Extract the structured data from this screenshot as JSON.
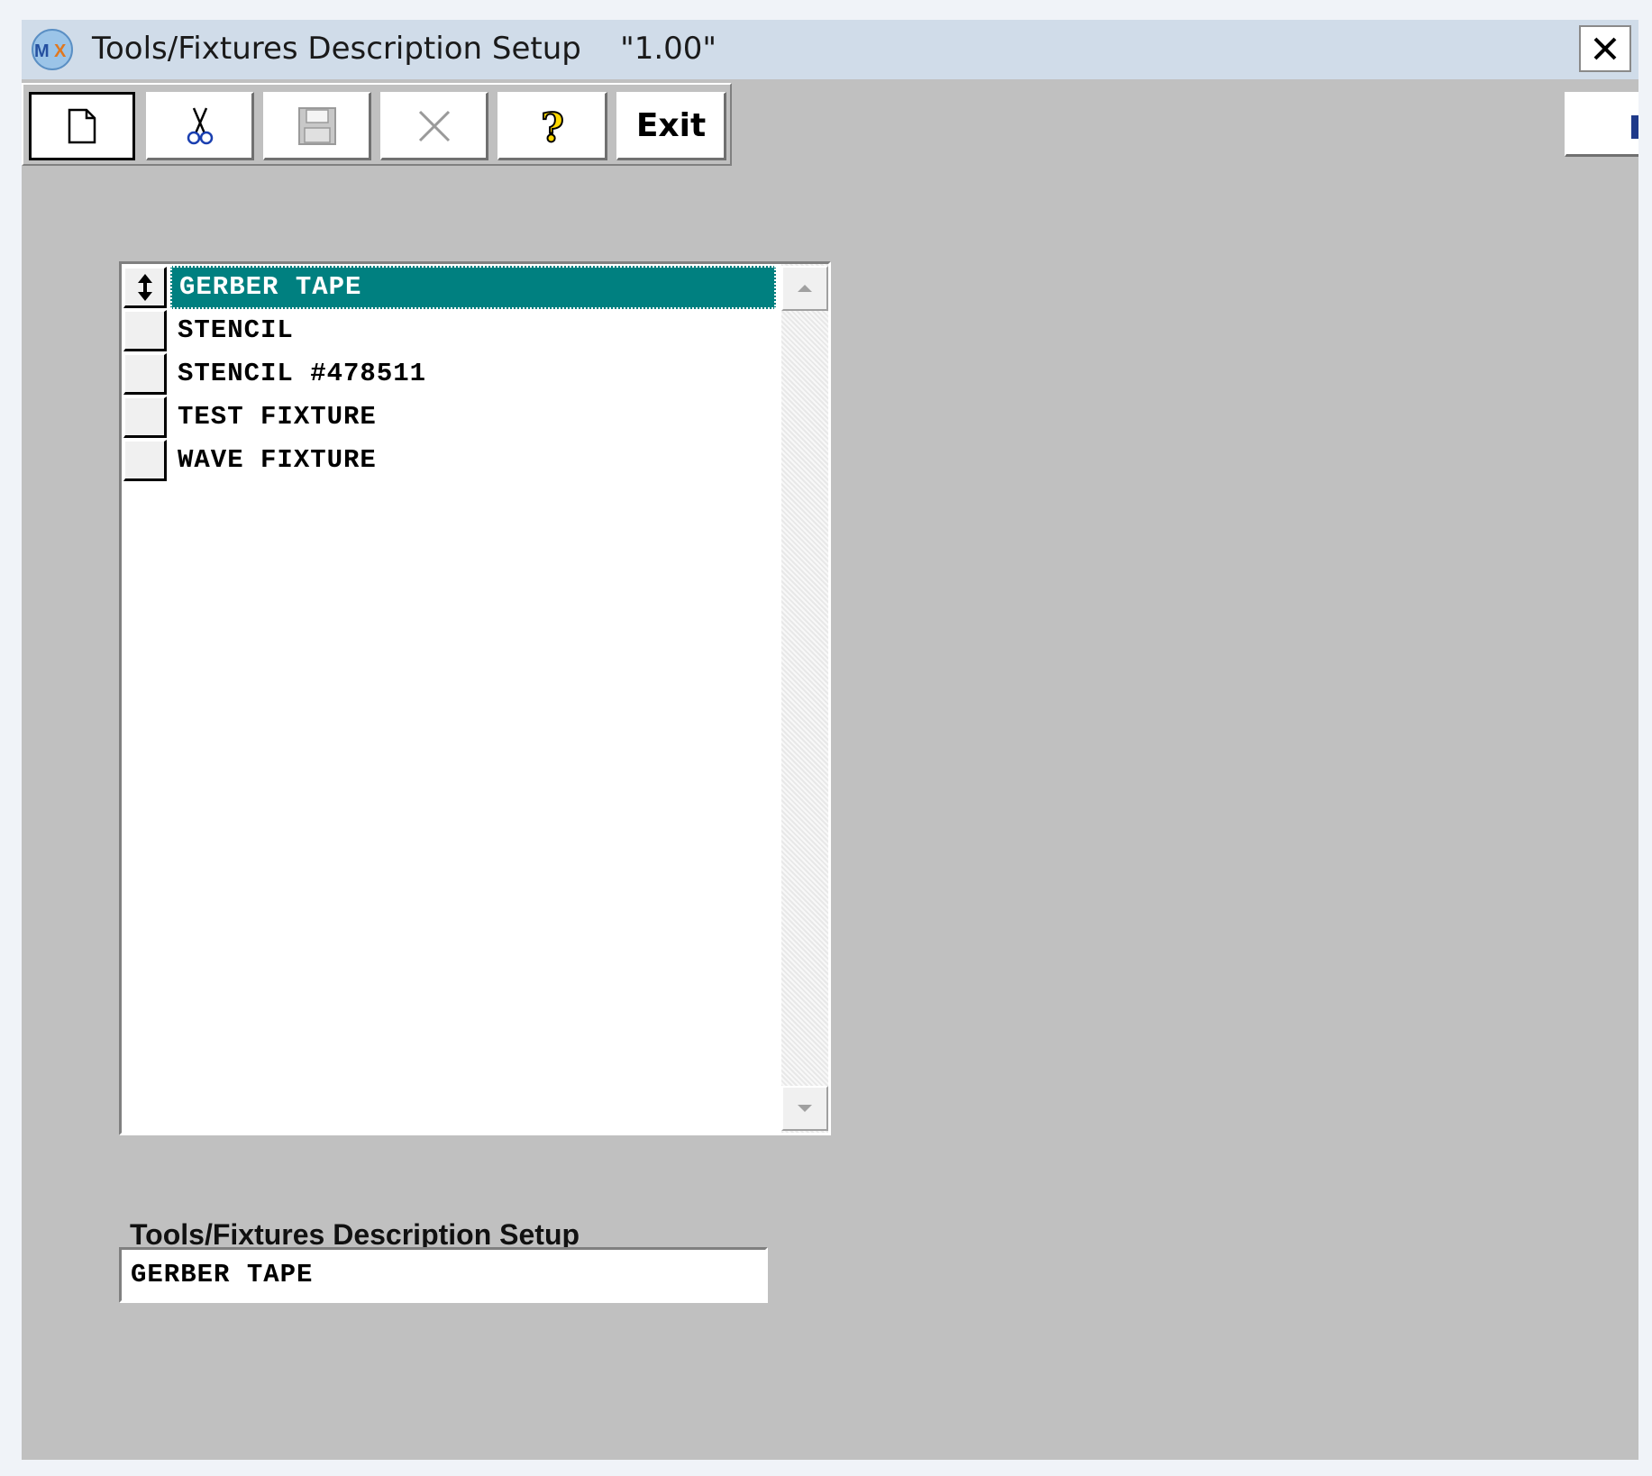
{
  "window": {
    "title": "Tools/Fixtures Description Setup",
    "version": "\"1.00\"",
    "app_icon": "mx-app-icon",
    "close_icon": "close-icon"
  },
  "toolbar": {
    "buttons": [
      {
        "name": "new",
        "icon": "new-document-icon",
        "enabled": true
      },
      {
        "name": "cut",
        "icon": "scissors-icon",
        "enabled": true
      },
      {
        "name": "save",
        "icon": "floppy-disk-icon",
        "enabled": false
      },
      {
        "name": "delete",
        "icon": "x-delete-icon",
        "enabled": false
      },
      {
        "name": "help",
        "icon": "question-mark-icon",
        "enabled": true
      },
      {
        "name": "exit",
        "label": "Exit",
        "enabled": true
      }
    ]
  },
  "list": {
    "items": [
      {
        "label": "GERBER TAPE",
        "selected": true
      },
      {
        "label": "STENCIL",
        "selected": false
      },
      {
        "label": "STENCIL #478511",
        "selected": false
      },
      {
        "label": "TEST FIXTURE",
        "selected": false
      },
      {
        "label": "WAVE FIXTURE",
        "selected": false
      }
    ],
    "selected_color": "#008080"
  },
  "detail": {
    "label": "Tools/Fixtures Description Setup",
    "value": "GERBER TAPE"
  }
}
